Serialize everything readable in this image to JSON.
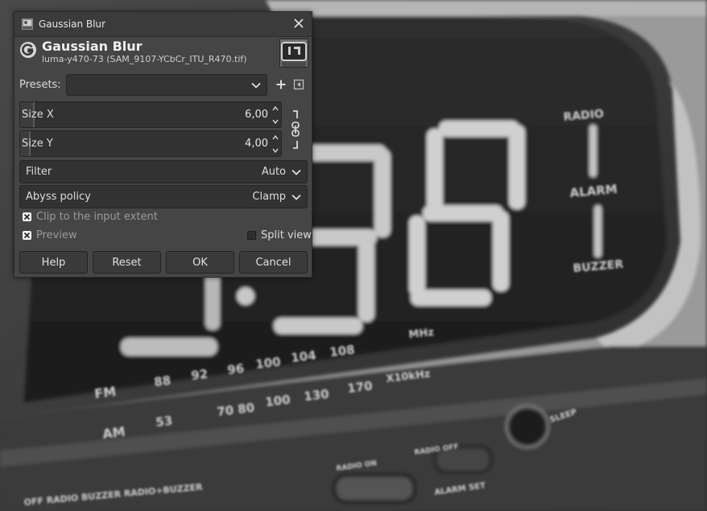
{
  "window": {
    "title": "Gaussian Blur"
  },
  "header": {
    "op_title": "Gaussian Blur",
    "op_subtitle": "luma-y470-73 (SAM_9107-YCbCr_ITU_R470.tif)"
  },
  "presets": {
    "label": "Presets:",
    "value": ""
  },
  "size_x": {
    "label": "Size X",
    "value": "6,00",
    "fill_fraction": 0.05
  },
  "size_y": {
    "label": "Size Y",
    "value": "4,00",
    "fill_fraction": 0.035
  },
  "filter": {
    "label": "Filter",
    "value": "Auto"
  },
  "abyss": {
    "label": "Abyss policy",
    "value": "Clamp"
  },
  "clip": {
    "label": "Clip to the input extent",
    "checked": true
  },
  "preview": {
    "label": "Preview",
    "checked": true
  },
  "split_view": {
    "label": "Split view",
    "checked": false
  },
  "buttons": {
    "help": "Help",
    "reset": "Reset",
    "ok": "OK",
    "cancel": "Cancel"
  },
  "background_display": {
    "lcd_digits": "38",
    "scale_fm": [
      "FM",
      "88",
      "92",
      "96",
      "100",
      "104",
      "108"
    ],
    "scale_am": [
      "AM",
      "53",
      "70",
      "80",
      "100",
      "130",
      "170",
      "X10kHz"
    ],
    "mhz": "MHz",
    "side_labels": [
      "RADIO",
      "ALARM",
      "BUZZER"
    ],
    "sleep": "SLEEP",
    "bottom_labels": [
      "OFF",
      "RADIO",
      "BUZZER",
      "RADIO+BUZZER",
      "RADIO ON",
      "RADIO OFF",
      "ALARM SET"
    ]
  },
  "colors": {
    "dialog_bg": "#454545",
    "field_bg": "#323232",
    "title_bg": "#3b3b3b"
  }
}
